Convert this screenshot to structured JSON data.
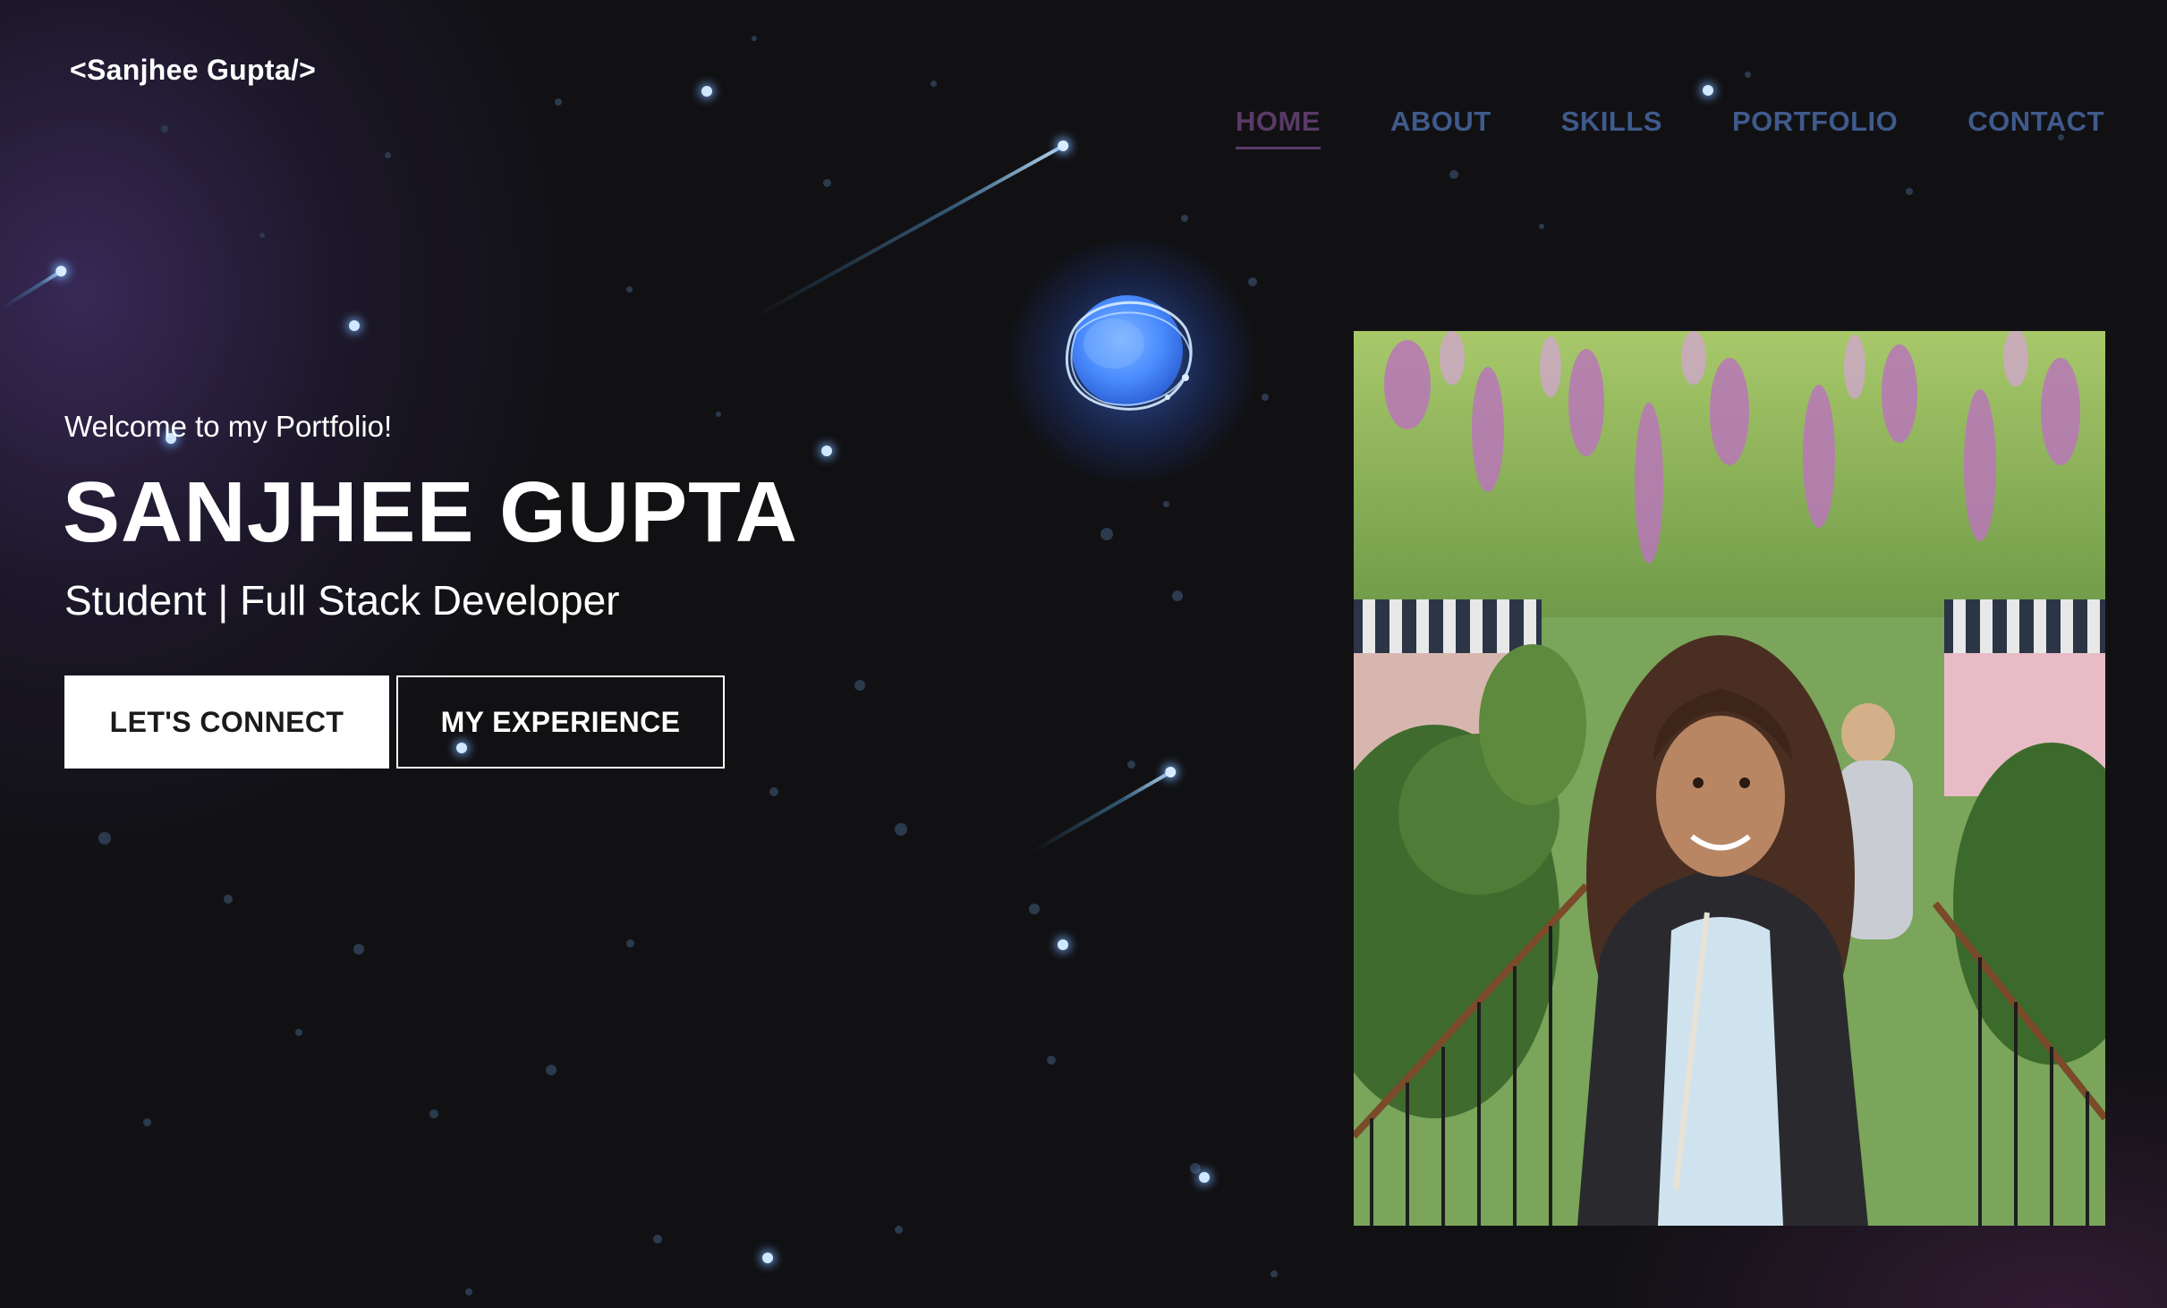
{
  "site": {
    "logo": "<Sanjhee Gupta/>"
  },
  "nav": {
    "items": [
      {
        "label": "HOME",
        "active": true
      },
      {
        "label": "ABOUT",
        "active": false
      },
      {
        "label": "SKILLS",
        "active": false
      },
      {
        "label": "PORTFOLIO",
        "active": false
      },
      {
        "label": "CONTACT",
        "active": false
      }
    ]
  },
  "hero": {
    "welcome": "Welcome to my Portfolio!",
    "name": "SANJHEE GUPTA",
    "role": "Student | Full Stack Developer",
    "primary_button": "LET'S CONNECT",
    "secondary_button": "MY EXPERIENCE"
  },
  "colors": {
    "background": "#111114",
    "nav_link": "#3f5a8c",
    "nav_active": "#5a3a68",
    "glow_purple": "#583c8c",
    "planet_blue": "#4a8cff"
  },
  "icons": {
    "planet": "glowing-blue-planet-icon"
  }
}
